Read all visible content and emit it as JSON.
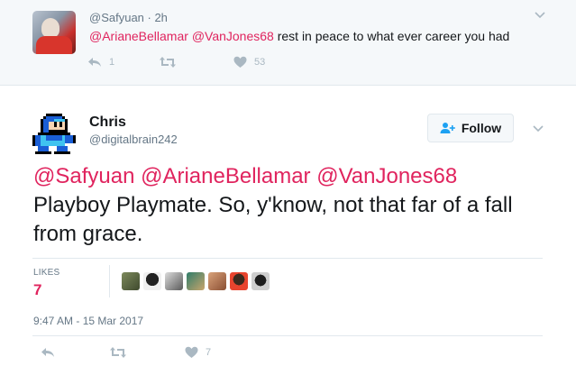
{
  "parent_tweet": {
    "handle_time": "@Safyuan · 2h",
    "mention1": "@ArianeBellamar",
    "mention2": "@VanJones68",
    "text": " rest in peace to what ever career you had",
    "reply_count": "1",
    "like_count": "53"
  },
  "main_tweet": {
    "name": "Chris",
    "handle": "@digitalbrain242",
    "follow_label": "Follow",
    "mentions": "@Safyuan @ArianeBellamar @VanJones68",
    "body": "Playboy Playmate. So, y'know, not that far of a fall from grace.",
    "likes_label": "LIKES",
    "likes_count": "7",
    "timestamp": "9:47 AM - 15 Mar 2017",
    "action_like_count": "7"
  },
  "colors": {
    "mention": "#e0245e",
    "secondary_text": "#657786",
    "icon_gray": "#aab8c2",
    "follow_icon": "#1da1f2"
  },
  "icons": {
    "reply": "reply-icon",
    "retweet": "retweet-icon",
    "like": "heart-icon",
    "menu": "chevron-down-icon",
    "follow": "add-person-icon"
  }
}
